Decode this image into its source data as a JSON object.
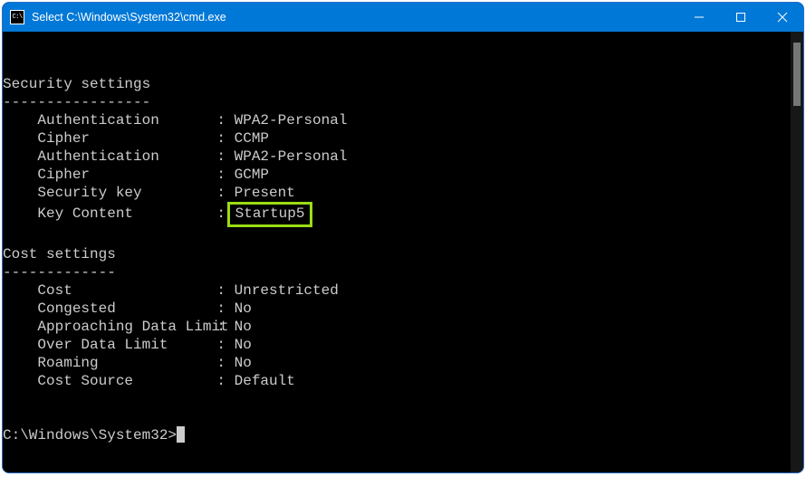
{
  "window": {
    "title": "Select C:\\Windows\\System32\\cmd.exe"
  },
  "terminal": {
    "sections": {
      "security": {
        "header": "Security settings",
        "divider": "-----------------",
        "items": [
          {
            "key": "Authentication",
            "value": "WPA2-Personal"
          },
          {
            "key": "Cipher",
            "value": "CCMP"
          },
          {
            "key": "Authentication",
            "value": "WPA2-Personal"
          },
          {
            "key": "Cipher",
            "value": "GCMP"
          },
          {
            "key": "Security key",
            "value": "Present"
          },
          {
            "key": "Key Content",
            "value": "Startup5",
            "highlighted": true
          }
        ]
      },
      "cost": {
        "header": "Cost settings",
        "divider": "-------------",
        "items": [
          {
            "key": "Cost",
            "value": "Unrestricted"
          },
          {
            "key": "Congested",
            "value": "No"
          },
          {
            "key": "Approaching Data Limit",
            "value": "No"
          },
          {
            "key": "Over Data Limit",
            "value": "No"
          },
          {
            "key": "Roaming",
            "value": "No"
          },
          {
            "key": "Cost Source",
            "value": "Default"
          }
        ]
      }
    },
    "prompt": "C:\\Windows\\System32>"
  },
  "colors": {
    "titlebar": "#0078d7",
    "highlight": "#9bdc14",
    "terminal_bg": "#000000",
    "terminal_fg": "#cccccc"
  }
}
